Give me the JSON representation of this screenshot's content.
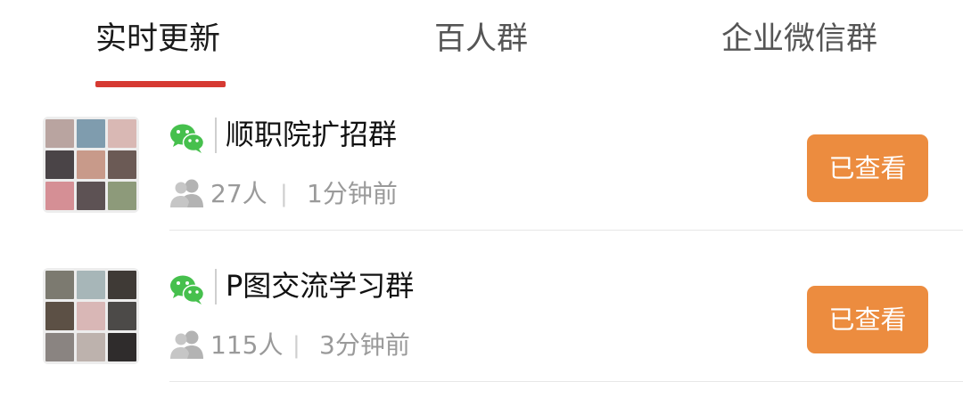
{
  "tabs": [
    {
      "label": "实时更新",
      "active": true
    },
    {
      "label": "百人群",
      "active": false
    },
    {
      "label": "企业微信群",
      "active": false
    }
  ],
  "colors": {
    "accent_underline": "#d63a32",
    "viewed_button": "#ec8c3f",
    "wechat_green": "#46c04d",
    "meta_gray": "#9a9a9a"
  },
  "groups": [
    {
      "icon": "wechat-icon",
      "name": "顺职院扩招群",
      "member_icon": "people-icon",
      "member_count": "27人",
      "separator": "|",
      "time": "1分钟前",
      "button_label": "已查看"
    },
    {
      "icon": "wechat-icon",
      "name": "P图交流学习群",
      "member_icon": "people-icon",
      "member_count": "115人",
      "separator": "|",
      "time": "3分钟前",
      "button_label": "已查看"
    }
  ]
}
